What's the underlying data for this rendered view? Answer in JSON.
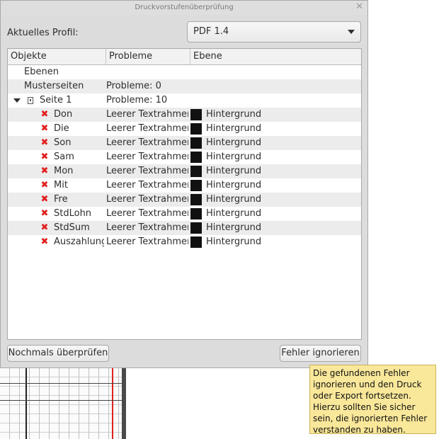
{
  "window": {
    "title": "Druckvorstufenüberprüfung"
  },
  "profile": {
    "label": "Aktuelles Profil:",
    "selected": "PDF 1.4"
  },
  "tree": {
    "columns": [
      "Objekte",
      "Probleme",
      "Ebene"
    ],
    "rows": [
      {
        "object": "Ebenen",
        "problems": "",
        "layer": ""
      },
      {
        "object": "Musterseiten",
        "problems": "Probleme: 0",
        "layer": ""
      },
      {
        "object": "Seite 1",
        "problems": "Probleme: 10",
        "layer": ""
      },
      {
        "object": "Don",
        "problems": "Leerer Textrahmen",
        "layer": "Hintergrund"
      },
      {
        "object": "Die",
        "problems": "Leerer Textrahmen",
        "layer": "Hintergrund"
      },
      {
        "object": "Son",
        "problems": "Leerer Textrahmen",
        "layer": "Hintergrund"
      },
      {
        "object": "Sam",
        "problems": "Leerer Textrahmen",
        "layer": "Hintergrund"
      },
      {
        "object": "Mon",
        "problems": "Leerer Textrahmen",
        "layer": "Hintergrund"
      },
      {
        "object": "Mit",
        "problems": "Leerer Textrahmen",
        "layer": "Hintergrund"
      },
      {
        "object": "Fre",
        "problems": "Leerer Textrahmen",
        "layer": "Hintergrund"
      },
      {
        "object": "StdLohn",
        "problems": "Leerer Textrahmen",
        "layer": "Hintergrund"
      },
      {
        "object": "StdSum",
        "problems": "Leerer Textrahmen",
        "layer": "Hintergrund"
      },
      {
        "object": "Auszahlung",
        "problems": "Leerer Textrahmen",
        "layer": "Hintergrund"
      }
    ]
  },
  "buttons": {
    "recheck": "Nochmals überprüfen",
    "ignore": "Fehler ignorieren"
  },
  "tooltip": {
    "text": "Die gefundenen Fehler ignorieren und den Druck oder Export fortsetzen. Hierzu sollten Sie sicher sein, die ignorierten Fehler verstanden zu haben."
  },
  "colors": {
    "error": "#e0201f",
    "layer_swatch": "#111111",
    "tooltip_bg": "#f9e79a"
  }
}
